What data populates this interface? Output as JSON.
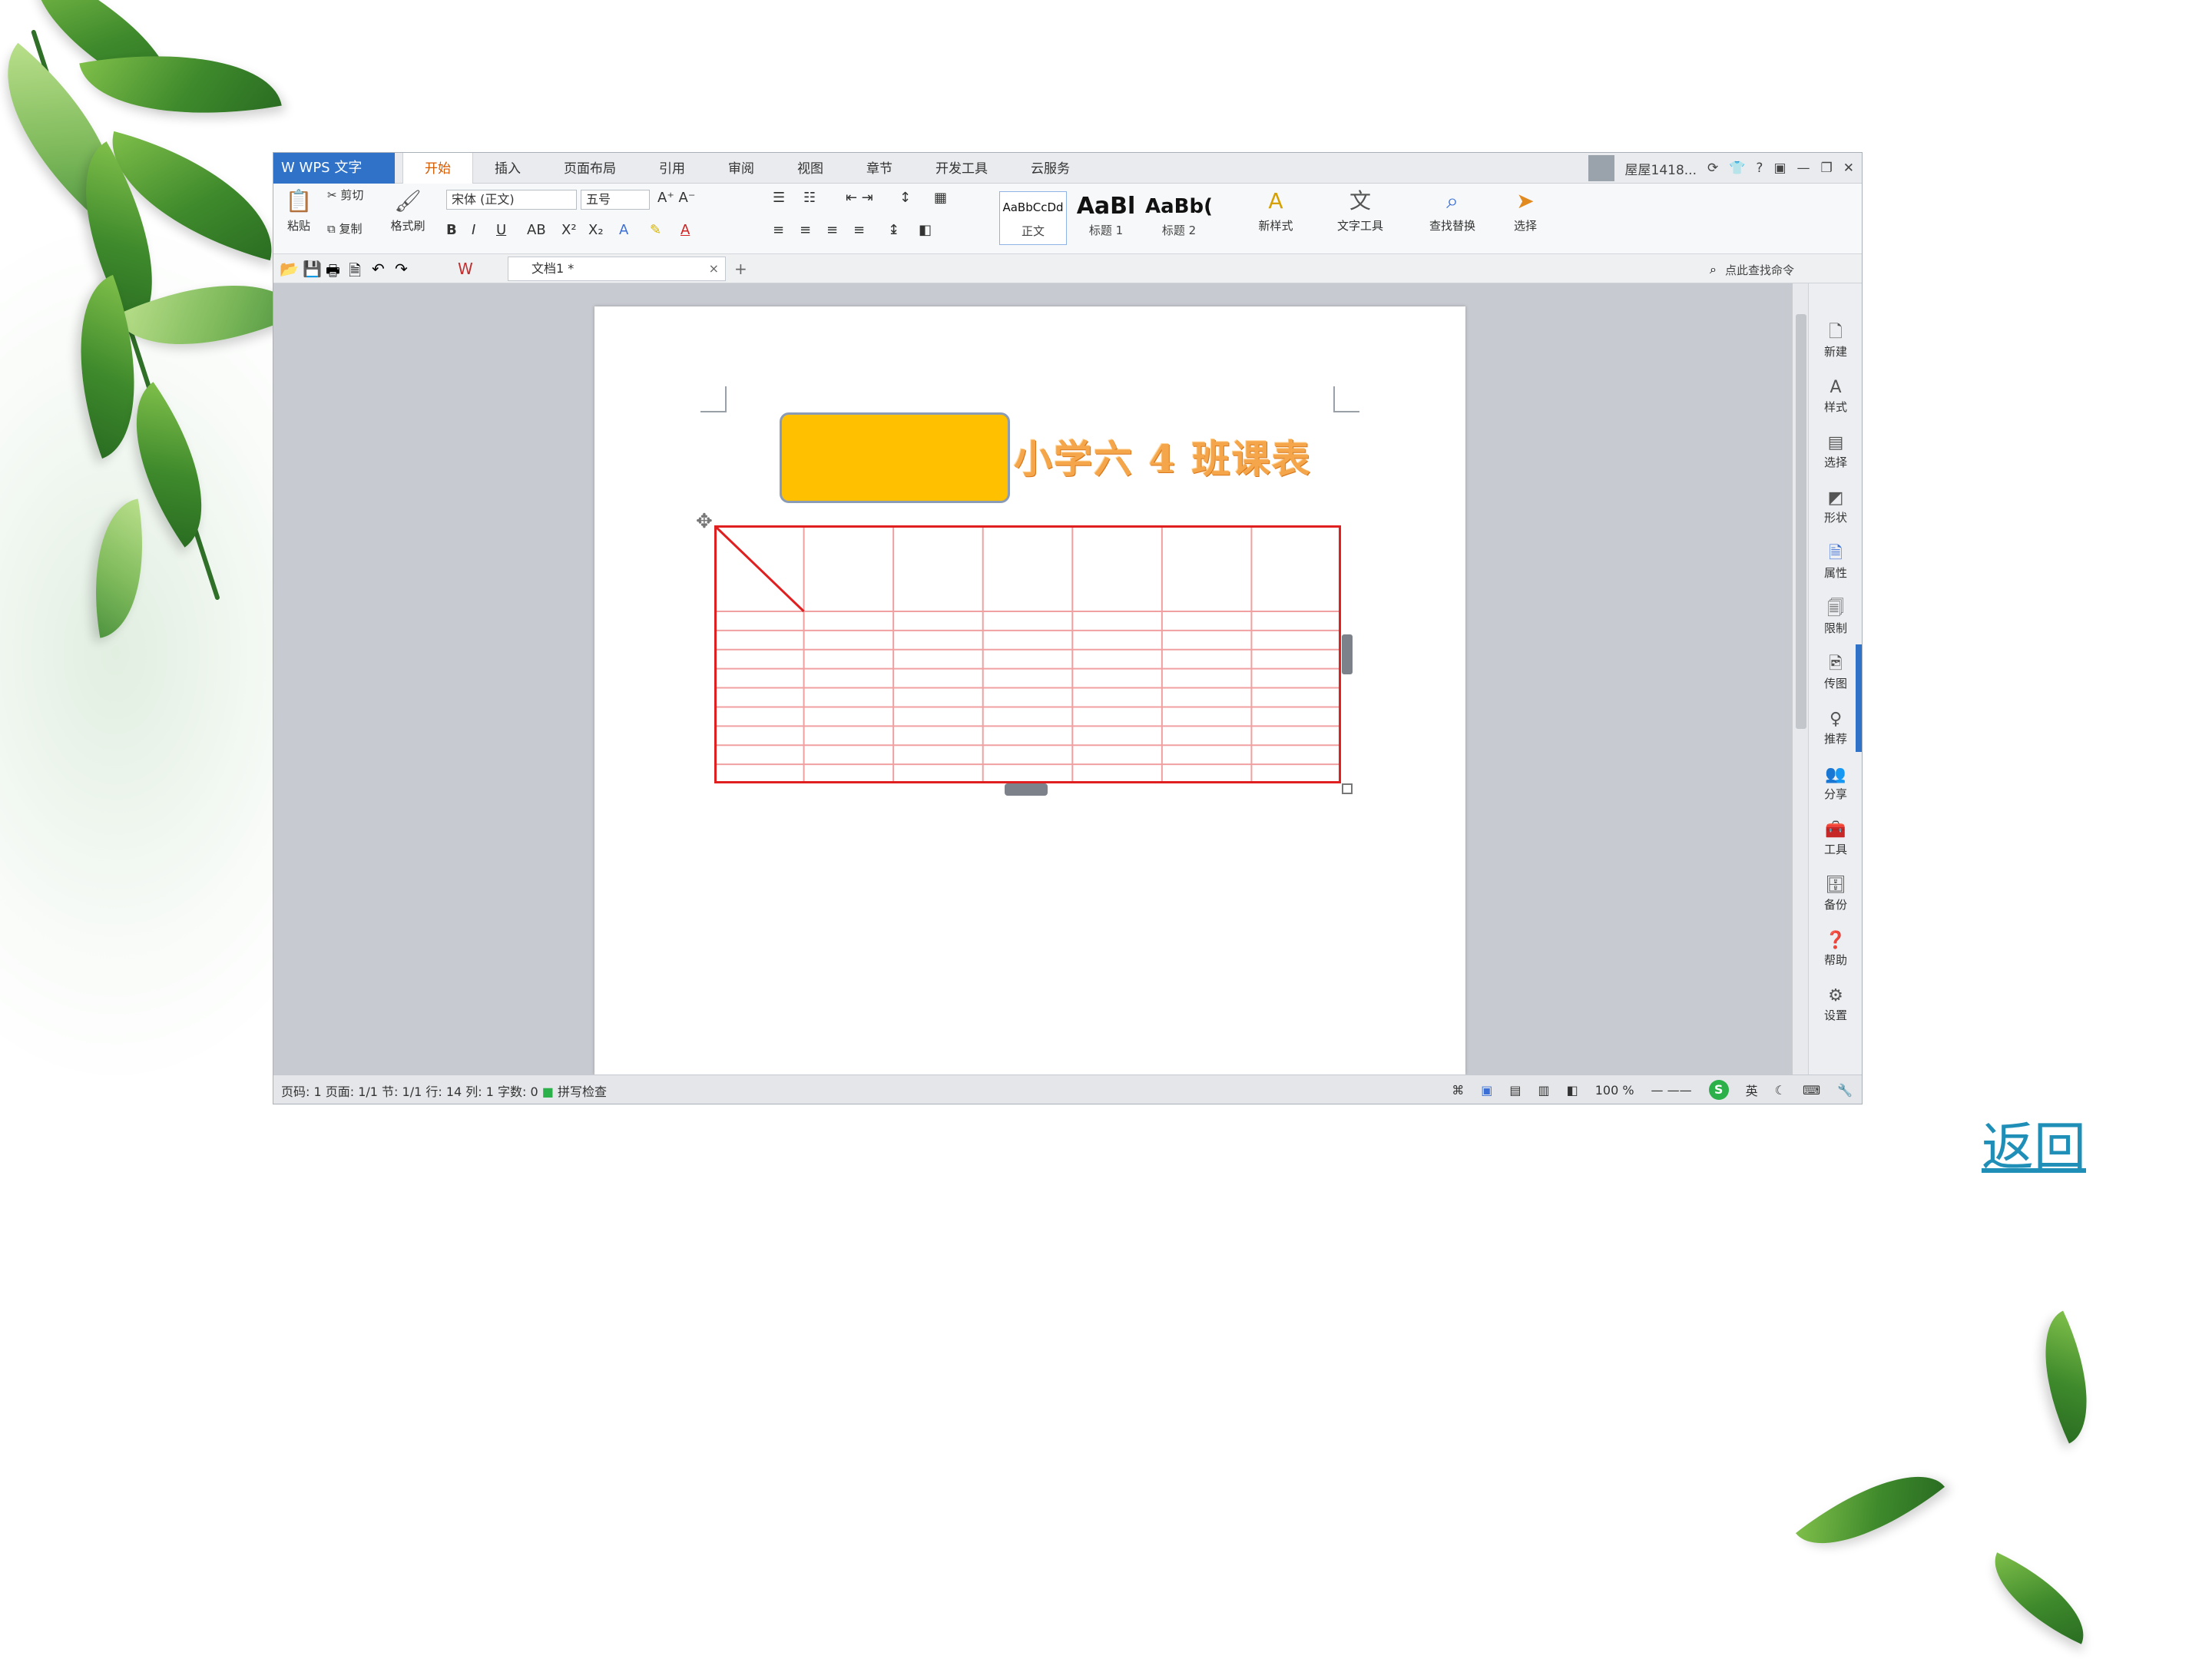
{
  "app": {
    "logo_label": "W WPS 文字",
    "tabs": [
      "开始",
      "插入",
      "页面布局",
      "引用",
      "审阅",
      "视图",
      "章节",
      "开发工具",
      "云服务"
    ],
    "user_name": "屋屋1418...",
    "window_controls": [
      "minimize-icon",
      "restore-icon",
      "close-icon"
    ]
  },
  "ribbon": {
    "paste_label": "粘贴",
    "cut_label": "剪切",
    "copy_label": "复制",
    "format_painter_label": "格式刷",
    "font_name": "宋体 (正文)",
    "font_size": "五号",
    "styles": [
      {
        "sample": "AaBbCcDd",
        "label": "正文"
      },
      {
        "sample": "AaBl",
        "label": "标题 1"
      },
      {
        "sample": "AaBb(",
        "label": "标题 2"
      }
    ],
    "new_style_label": "新样式",
    "text_tools_label": "文字工具",
    "find_replace_label": "查找替换",
    "select_label": "选择"
  },
  "quick_access": {
    "doc_tab_label": "文档1 *",
    "command_search_label": "点此查找命令"
  },
  "side_panel": {
    "items": [
      "新建",
      "样式",
      "选择",
      "形状",
      "属性",
      "限制",
      "传图",
      "推荐",
      "分享",
      "工具",
      "备份",
      "帮助",
      "设置"
    ]
  },
  "statusbar": {
    "left_text": "页码: 1  页面: 1/1  节: 1/1  行: 14  列: 1  字数: 0",
    "spellcheck_label": "拼写检查",
    "zoom_label": "100 %",
    "ime_label": "英"
  },
  "document": {
    "title": "小学六 4 班课表",
    "table_rows": 10,
    "table_cols": 7
  },
  "nav": {
    "back_label": "返回"
  },
  "colors": {
    "title_shape_fill": "#ffc000",
    "title_text": "#f5a64a",
    "table_outer": "#e02020",
    "table_inner": "#f0a0a0",
    "link": "#1f8fb8",
    "app_accent": "#2f72c8"
  }
}
